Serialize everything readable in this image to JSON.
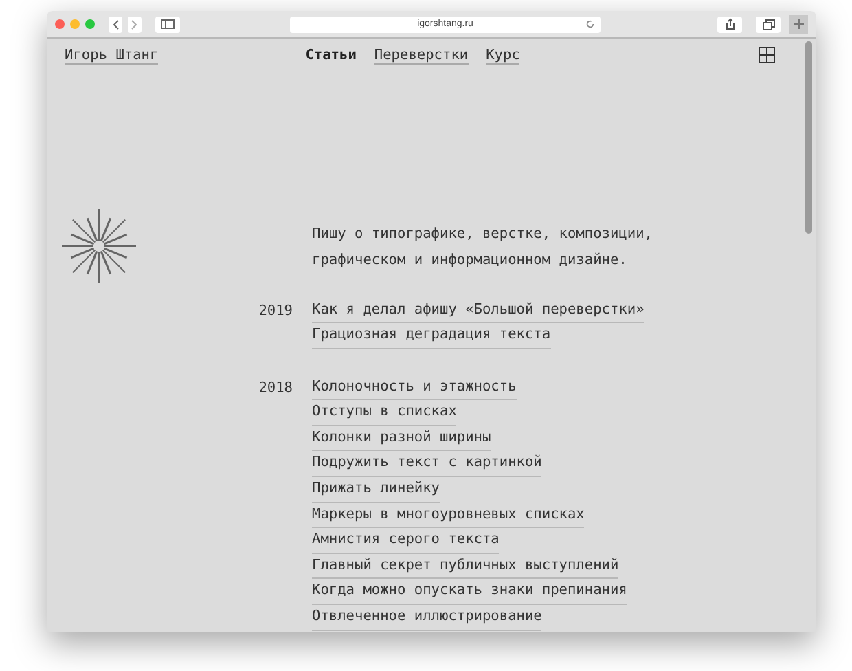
{
  "browser": {
    "url": "igorshtang.ru"
  },
  "site": {
    "name": "Игорь Штанг"
  },
  "nav": [
    {
      "label": "Статьи",
      "selected": true
    },
    {
      "label": "Переверстки",
      "selected": false
    },
    {
      "label": "Курс",
      "selected": false
    }
  ],
  "intro": [
    "Пишу о типографике, верстке, композиции,",
    "графическом и информационном дизайне."
  ],
  "years": [
    {
      "year": "2019",
      "articles": [
        "Как я делал афишу «Большой переверстки»",
        "Грациозная деградация текста"
      ]
    },
    {
      "year": "2018",
      "articles": [
        "Колоночность и этажность",
        "Отступы в списках",
        "Колонки разной ширины",
        "Подружить текст с картинкой",
        "Прижать линейку",
        "Маркеры в многоуровневых списках",
        "Амнистия серого текста",
        "Главный секрет публичных выступлений",
        "Когда можно опускать знаки препинания",
        "Отвлеченное иллюстрирование"
      ]
    }
  ]
}
